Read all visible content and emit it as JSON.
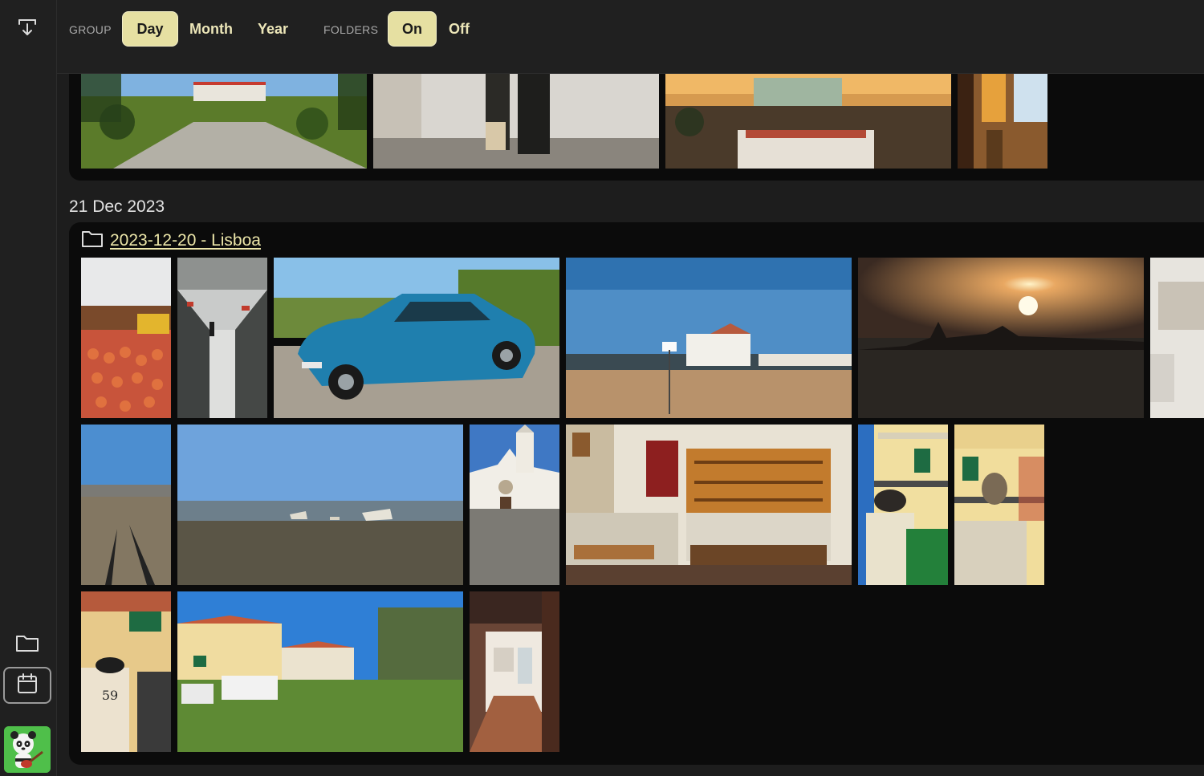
{
  "sidebar": {
    "items": [
      {
        "name": "download-icon",
        "kind": "download"
      },
      {
        "name": "folder-icon",
        "kind": "folders"
      },
      {
        "name": "calendar-icon",
        "kind": "timeline",
        "active": true
      }
    ],
    "avatar_icon": "panda-guitar-avatar"
  },
  "toolbar": {
    "group_label": "GROUP",
    "group_options": [
      "Day",
      "Month",
      "Year"
    ],
    "group_selected": "Day",
    "folders_label": "FOLDERS",
    "folders_options": [
      "On",
      "Off"
    ],
    "folders_selected": "On"
  },
  "sections": [
    {
      "date": "21 Dec 2023",
      "folder": "2023-12-20 - Lisboa",
      "photos": [
        "supermarket-fruit",
        "supermarket-aisle",
        "blue-classic-car",
        "beach-pavilion",
        "sunset-silhouette",
        "interior-partial",
        "shadows-on-tidal-flat",
        "low-tide-boats",
        "white-church",
        "bakery-counter",
        "cat-on-wall",
        "cat-on-balcony",
        "cat-on-mailbox-59",
        "townhouses-lawn",
        "hallway-interior"
      ]
    }
  ],
  "misc": {
    "house_number": "59"
  },
  "colors": {
    "accent": "#e6e0a2",
    "link": "#ece6a9",
    "avatar_bg": "#4fbf4a",
    "panel": "#0b0b0b"
  }
}
